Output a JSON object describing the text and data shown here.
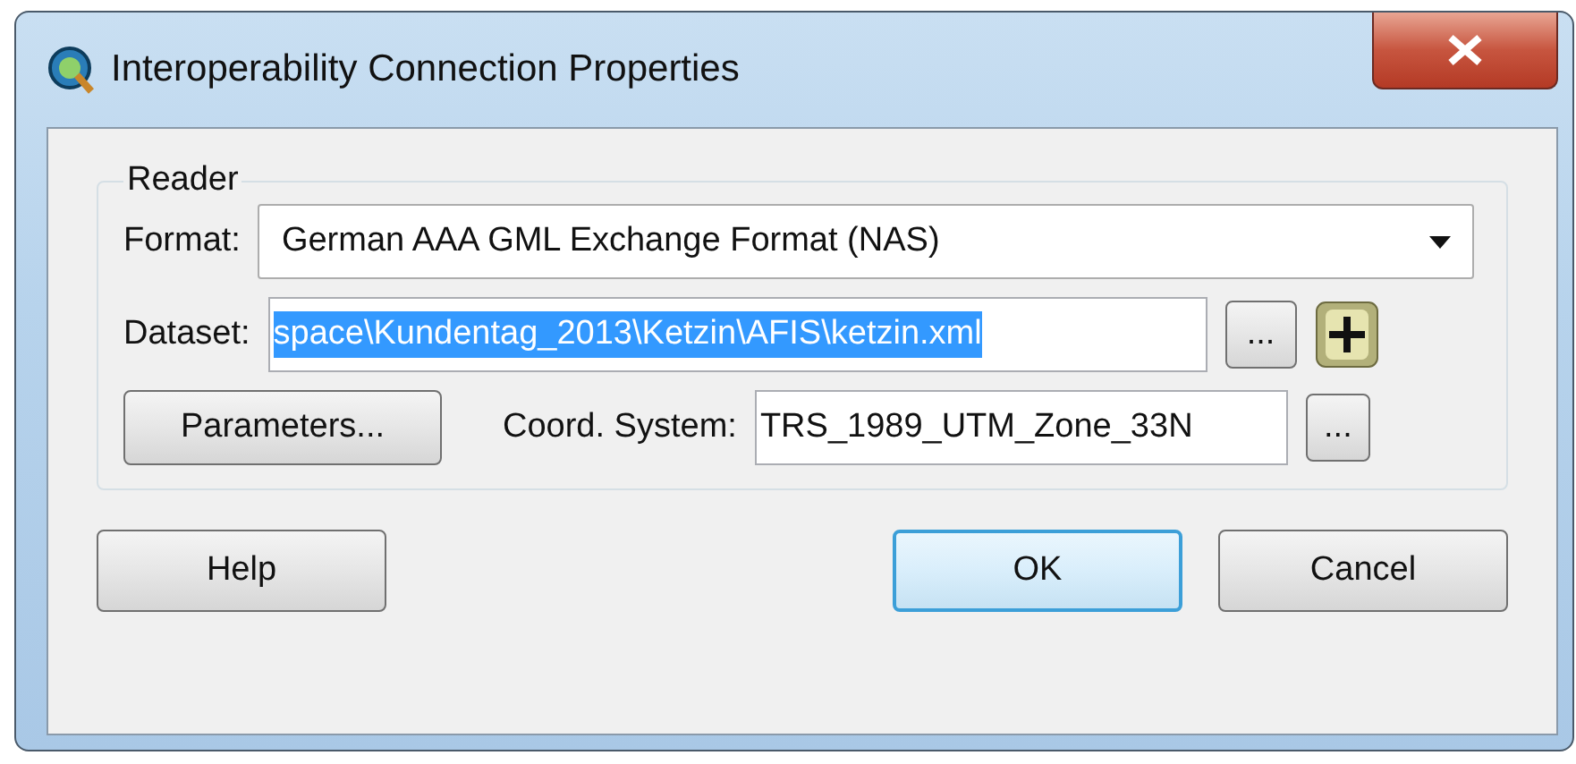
{
  "window": {
    "title": "Interoperability Connection Properties"
  },
  "reader": {
    "title": "Reader",
    "format": {
      "label": "Format:",
      "value": "German AAA GML Exchange Format (NAS)"
    },
    "dataset": {
      "label": "Dataset:",
      "value": "space\\Kundentag_2013\\Ketzin\\AFIS\\ketzin.xml",
      "selected": true,
      "browse": "..."
    },
    "parameters": "Parameters...",
    "coord_system": {
      "label": "Coord. System:",
      "value": "TRS_1989_UTM_Zone_33N",
      "browse": "..."
    }
  },
  "buttons": [
    {
      "label": "Help",
      "default": false
    },
    {
      "label": "OK",
      "default": true
    },
    {
      "label": "Cancel",
      "default": false
    }
  ]
}
